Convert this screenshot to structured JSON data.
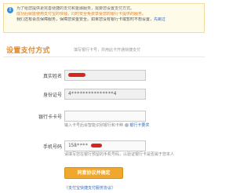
{
  "notice": {
    "line1": "为了给您提供更完善便捷的支付和金融服务，需要您设置支付方式。",
    "line2": "成功后就能使用支付宝的快钱，同时安全免费享受您的银行卡提供的服务。",
    "line3": "我们还有会员保障服务，保障您资金安全。如果您没有银行卡或暂时不想设置，",
    "line3_link": "先跳过"
  },
  "section": {
    "title": "设置支付方式",
    "subtitle": "填写银行卡号，并用此卡开通快捷支付"
  },
  "form": {
    "name": {
      "label": "真实姓名",
      "value": ""
    },
    "id_number": {
      "label": "身份证号",
      "value": "4***************4"
    },
    "card": {
      "label": "银行卡卡号",
      "value": "",
      "hint": "输入卡号后会智能识别银行和卡种",
      "hint_link": "银行卡要求"
    },
    "phone": {
      "label": "手机号码",
      "value": "158****",
      "hint": "请填写您在银行预留的手机号码，以验证银行卡是否属于您本人"
    }
  },
  "submit_label": "同意协议并确定",
  "agreement": {
    "prefix": "《",
    "link": "支付宝快捷支付服务协议",
    "suffix": "》"
  },
  "colors": {
    "accent": "#f0a72e",
    "title": "#e58a2a",
    "link": "#2b6cc4",
    "redaction": "#d7261e"
  }
}
